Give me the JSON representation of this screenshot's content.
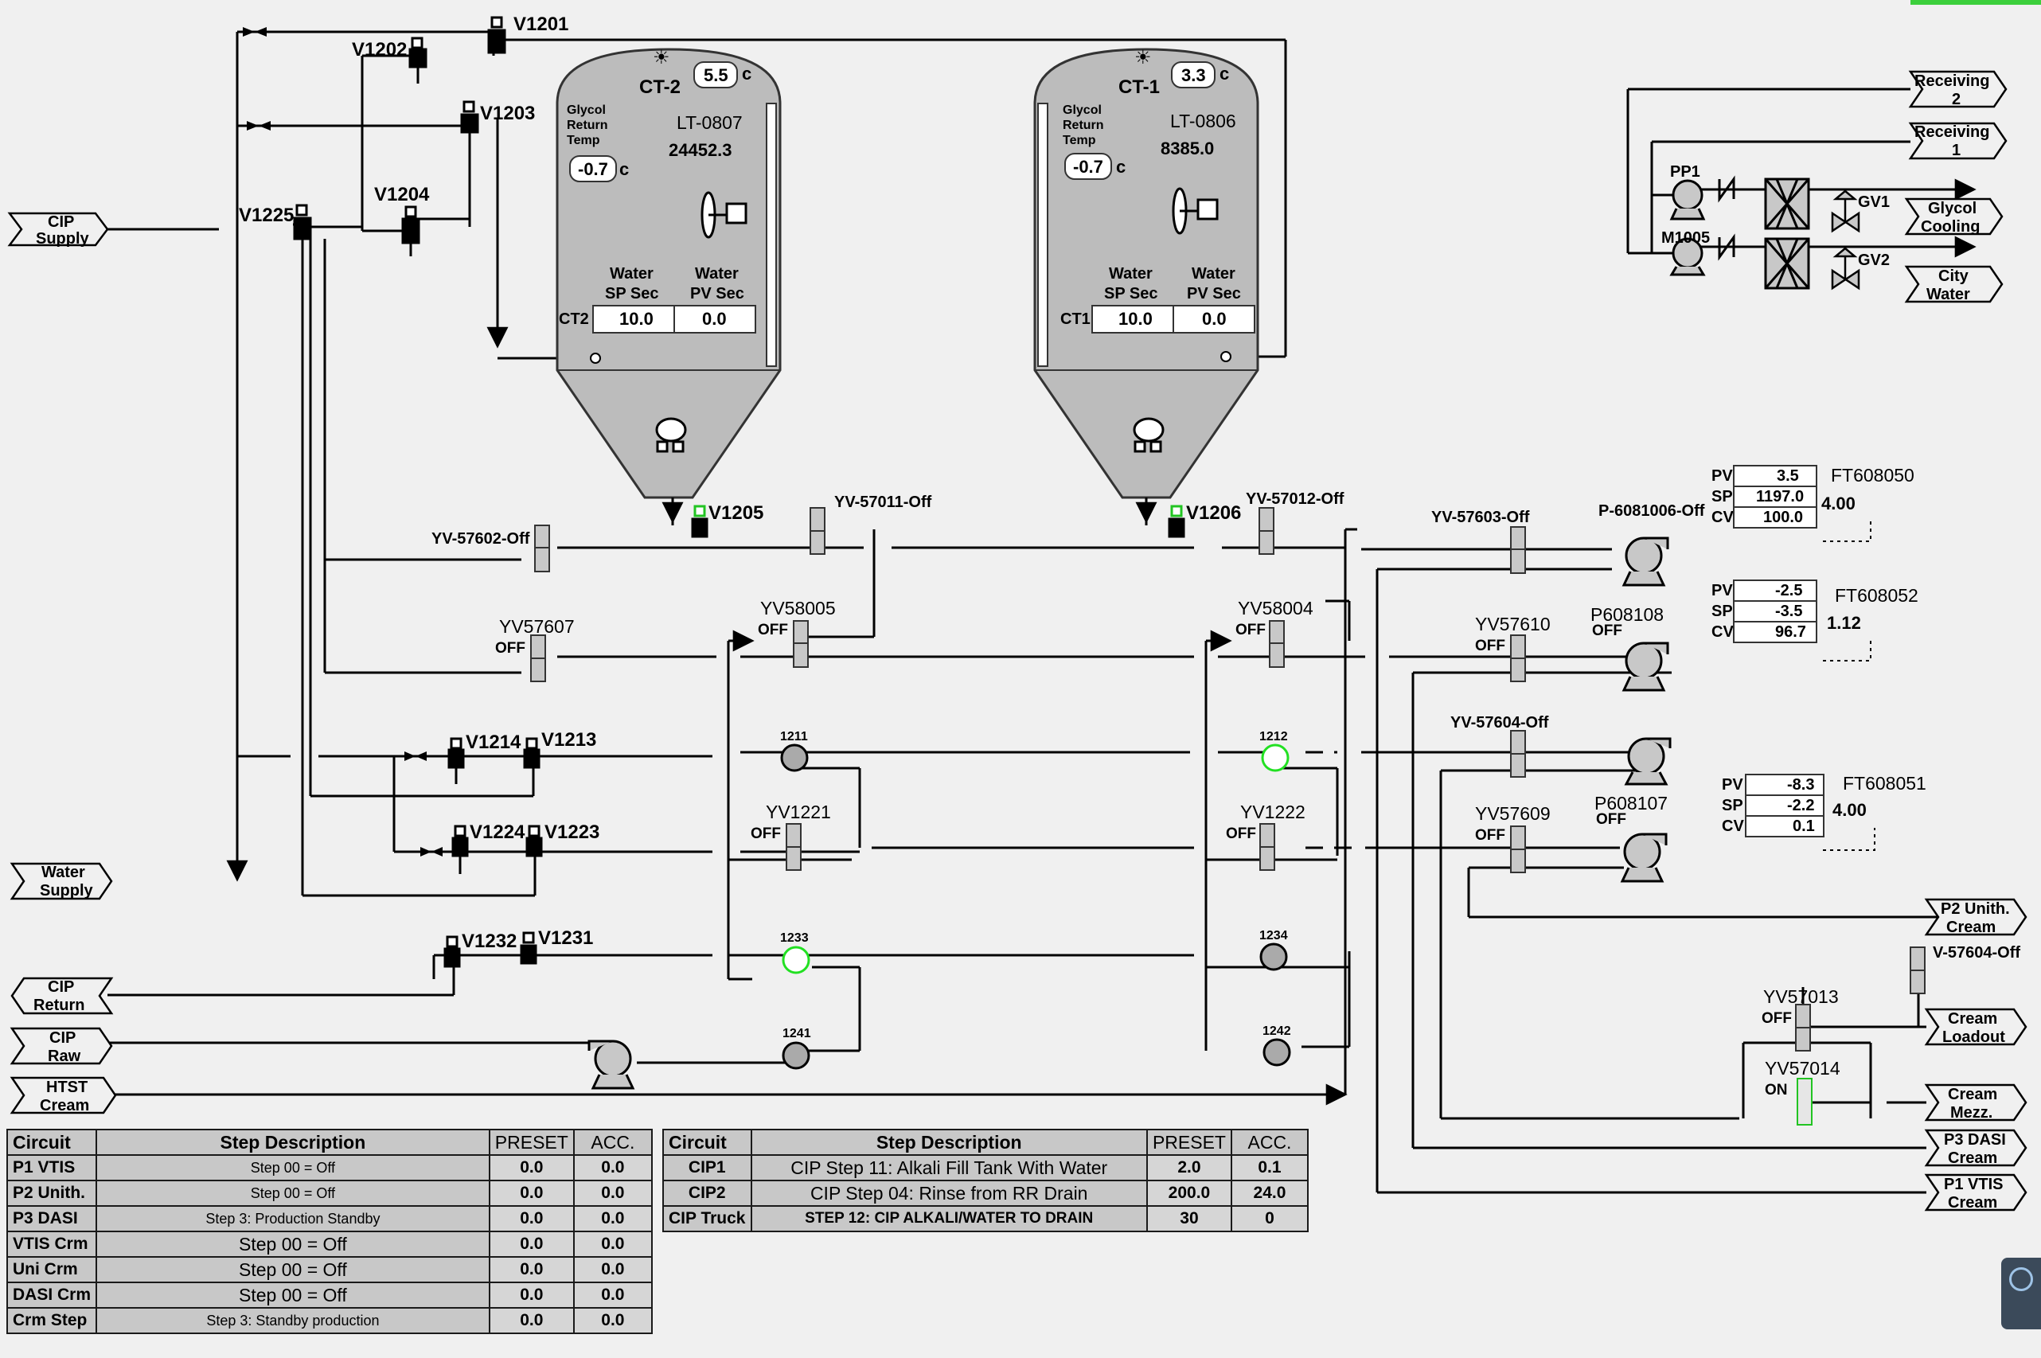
{
  "colors": {
    "background": "#f0f0f0",
    "pipe": "#000000",
    "vessel": "#bcbcbc",
    "active_valve": "#22c422",
    "status_strip": "#3ccf3c"
  },
  "ports": {
    "cip_supply": [
      "CIP",
      "Supply"
    ],
    "water_supply": [
      "Water",
      "Supply"
    ],
    "cip_return": [
      "CIP",
      "Return"
    ],
    "cip_raw": [
      "CIP",
      "Raw"
    ],
    "htst_cream": [
      "HTST",
      "Cream"
    ],
    "receiving2": [
      "Receiving",
      "2"
    ],
    "receiving1": [
      "Receiving",
      "1"
    ],
    "glycol_cooling": [
      "Glycol",
      "Cooling"
    ],
    "city_water": [
      "City",
      "Water"
    ],
    "p2_unith_cream": [
      "P2 Unith.",
      "Cream"
    ],
    "cream_loadout": [
      "Cream",
      "Loadout"
    ],
    "cream_mezz": [
      "Cream",
      "Mezz."
    ],
    "p3_dasi_cream": [
      "P3 DASI",
      "Cream"
    ],
    "p1_vtis_cream": [
      "P1 VTIS",
      "Cream"
    ]
  },
  "tanks": {
    "ct2": {
      "name": "CT-2",
      "temp": "5.5",
      "temp_unit": "c",
      "glycol_label": [
        "Glycol",
        "Return",
        "Temp"
      ],
      "glycol_temp": "-0.7",
      "glycol_unit": "c",
      "level_tag": "LT-0807",
      "level_value": "24452.3",
      "circuit": "CT2",
      "sp_header": [
        "Water",
        "SP Sec"
      ],
      "pv_header": [
        "Water",
        "PV Sec"
      ],
      "sp": "10.0",
      "pv": "0.0"
    },
    "ct1": {
      "name": "CT-1",
      "temp": "3.3",
      "temp_unit": "c",
      "glycol_label": [
        "Glycol",
        "Return",
        "Temp"
      ],
      "glycol_temp": "-0.7",
      "glycol_unit": "c",
      "level_tag": "LT-0806",
      "level_value": "8385.0",
      "circuit": "CT1",
      "sp_header": [
        "Water",
        "SP Sec"
      ],
      "pv_header": [
        "Water",
        "PV Sec"
      ],
      "sp": "10.0",
      "pv": "0.0"
    }
  },
  "valves": {
    "v1201": "V1201",
    "v1202": "V1202",
    "v1203": "V1203",
    "v1204": "V1204",
    "v1225": "V1225",
    "v1205": "V1205",
    "v1206": "V1206",
    "v1214": "V1214",
    "v1213": "V1213",
    "v1224": "V1224",
    "v1223": "V1223",
    "v1232": "V1232",
    "v1231": "V1231",
    "yv57011": "YV-57011-Off",
    "yv57012": "YV-57012-Off",
    "yv57602": "YV-57602-Off",
    "yv57603": "YV-57603-Off",
    "yv57604": "YV-57604-Off",
    "v57604": "V-57604-Off",
    "yv57607": "YV57607",
    "yv58005": "YV58005",
    "yv58004": "YV58004",
    "yv57610": "YV57610",
    "yv1221": "YV1221",
    "yv1222": "YV1222",
    "yv57609": "YV57609",
    "yv57013": "YV57013",
    "yv57014": "YV57014",
    "gv1": "GV1",
    "gv2": "GV2",
    "off": "OFF",
    "on": "ON"
  },
  "pumps": {
    "pp1": "PP1",
    "m1005": "M1005",
    "p6081006": "P-6081006-Off",
    "p608108": "P608108",
    "p608107": "P608107",
    "off": "OFF"
  },
  "nodes": {
    "n1211": "1211",
    "n1212": "1212",
    "n1233": "1233",
    "n1234": "1234",
    "n1241": "1241",
    "n1242": "1242"
  },
  "flow": {
    "labels": {
      "pv": "PV",
      "sp": "SP",
      "cv": "CV"
    },
    "ft608050": {
      "tag": "FT608050",
      "pv": "3.5",
      "sp": "1197.0",
      "cv": "100.0",
      "value": "4.00"
    },
    "ft608052": {
      "tag": "FT608052",
      "pv": "-2.5",
      "sp": "-3.5",
      "cv": "96.7",
      "value": "1.12"
    },
    "ft608051": {
      "tag": "FT608051",
      "pv": "-8.3",
      "sp": "-2.2",
      "cv": "0.1",
      "value": "4.00"
    }
  },
  "table1": {
    "headers": [
      "Circuit",
      "Step Description",
      "PRESET",
      "ACC."
    ],
    "rows": [
      {
        "circuit": "P1 VTIS",
        "desc": "Step 00 = Off",
        "preset": "0.0",
        "acc": "0.0"
      },
      {
        "circuit": "P2 Unith.",
        "desc": "Step 00 = Off",
        "preset": "0.0",
        "acc": "0.0"
      },
      {
        "circuit": "P3 DASI",
        "desc": "Step 3: Production Standby",
        "preset": "0.0",
        "acc": "0.0"
      },
      {
        "circuit": "VTIS Crm",
        "desc": "Step 00 = Off",
        "preset": "0.0",
        "acc": "0.0"
      },
      {
        "circuit": "Uni Crm",
        "desc": "Step 00 = Off",
        "preset": "0.0",
        "acc": "0.0"
      },
      {
        "circuit": "DASI Crm",
        "desc": "Step 00 = Off",
        "preset": "0.0",
        "acc": "0.0"
      },
      {
        "circuit": "Crm Step",
        "desc": "Step 3: Standby production",
        "preset": "0.0",
        "acc": "0.0"
      }
    ]
  },
  "table2": {
    "headers": [
      "Circuit",
      "Step Description",
      "PRESET",
      "ACC."
    ],
    "rows": [
      {
        "circuit": "CIP1",
        "desc": "CIP Step 11: Alkali Fill Tank With Water",
        "preset": "2.0",
        "acc": "0.1"
      },
      {
        "circuit": "CIP2",
        "desc": "CIP Step 04: Rinse from RR Drain",
        "preset": "200.0",
        "acc": "24.0"
      },
      {
        "circuit": "CIP Truck",
        "desc": "STEP 12: CIP ALKALI/WATER TO DRAIN",
        "preset": "30",
        "acc": "0"
      }
    ]
  }
}
